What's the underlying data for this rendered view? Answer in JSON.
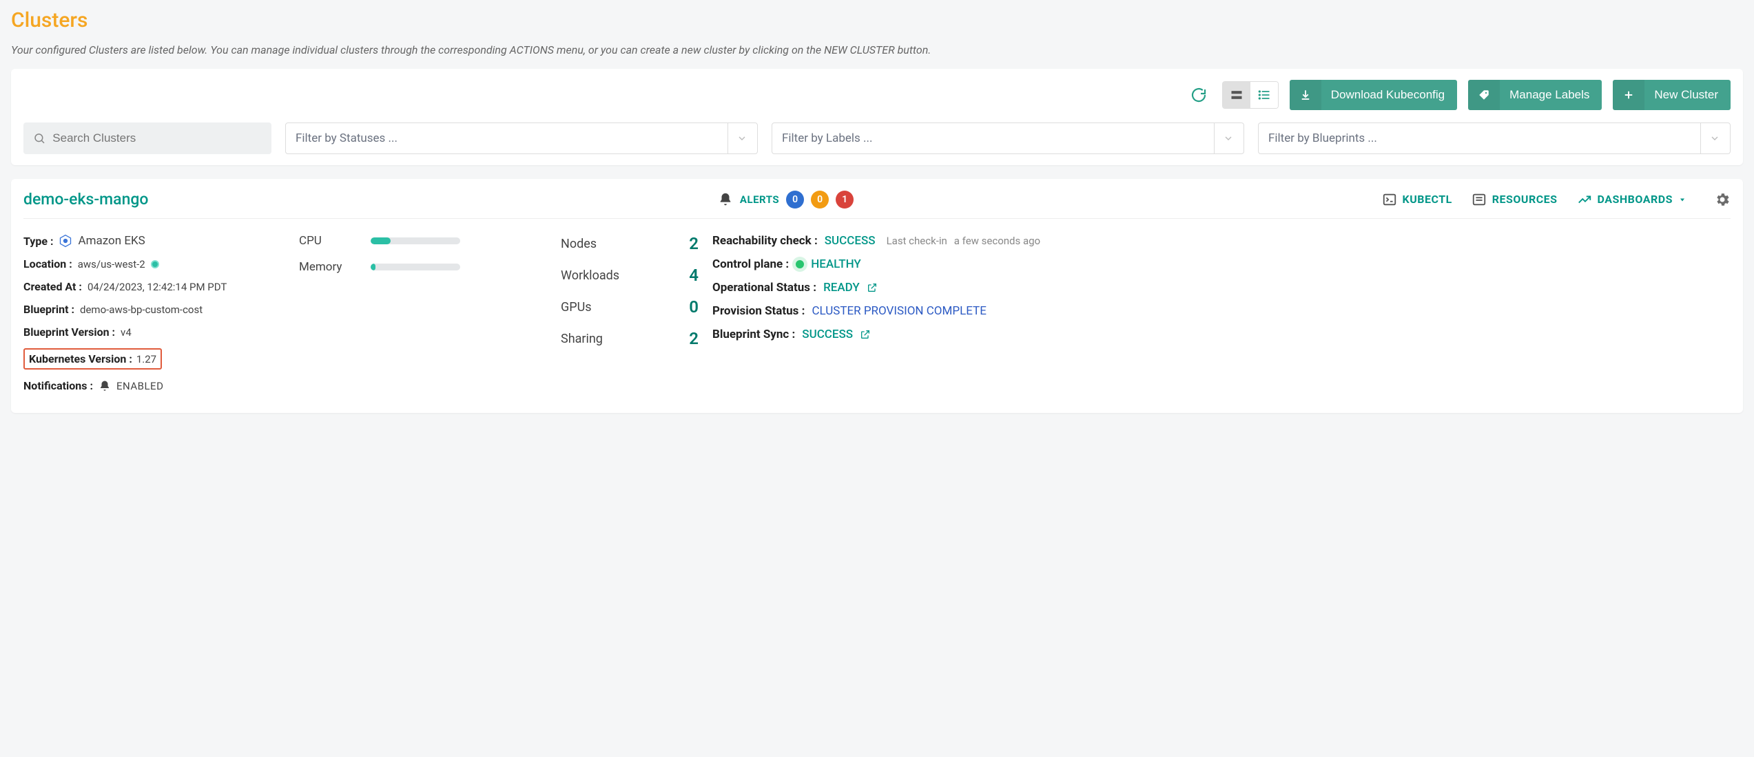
{
  "page": {
    "title": "Clusters",
    "subtitle": "Your configured Clusters are listed below. You can manage individual clusters through the corresponding ACTIONS menu, or you can create a new cluster by clicking on the NEW CLUSTER button."
  },
  "toolbar": {
    "download_label": "Download Kubeconfig",
    "manage_labels": "Manage Labels",
    "new_cluster": "New Cluster"
  },
  "filters": {
    "search_placeholder": "Search Clusters",
    "status_placeholder": "Filter by Statuses ...",
    "labels_placeholder": "Filter by Labels ...",
    "blueprints_placeholder": "Filter by Blueprints ..."
  },
  "cluster": {
    "name": "demo-eks-mango",
    "alerts_label": "ALERTS",
    "alerts": {
      "info": "0",
      "warn": "0",
      "error": "1"
    },
    "links": {
      "kubectl": "KUBECTL",
      "resources": "RESOURCES",
      "dashboards": "DASHBOARDS"
    },
    "meta": {
      "type_label": "Type :",
      "type_value": "Amazon EKS",
      "location_label": "Location :",
      "location_value": "aws/us-west-2",
      "created_label": "Created At :",
      "created_value": "04/24/2023, 12:42:14 PM PDT",
      "blueprint_label": "Blueprint :",
      "blueprint_value": "demo-aws-bp-custom-cost",
      "bpver_label": "Blueprint Version :",
      "bpver_value": "v4",
      "k8s_label": "Kubernetes Version :",
      "k8s_value": "1.27",
      "notif_label": "Notifications :",
      "notif_value": "ENABLED"
    },
    "resources": {
      "cpu_label": "CPU",
      "cpu_pct": 22,
      "mem_label": "Memory",
      "mem_pct": 5
    },
    "counts": {
      "nodes_label": "Nodes",
      "nodes": "2",
      "workloads_label": "Workloads",
      "workloads": "4",
      "gpus_label": "GPUs",
      "gpus": "0",
      "sharing_label": "Sharing",
      "sharing": "2"
    },
    "status": {
      "reach_label": "Reachability check :",
      "reach_value": "SUCCESS",
      "reach_sub1": "Last check-in",
      "reach_sub2": "a few seconds ago",
      "cp_label": "Control plane :",
      "cp_value": "HEALTHY",
      "op_label": "Operational Status :",
      "op_value": "READY",
      "prov_label": "Provision Status :",
      "prov_value": "CLUSTER PROVISION COMPLETE",
      "bpsync_label": "Blueprint Sync :",
      "bpsync_value": "SUCCESS"
    }
  }
}
